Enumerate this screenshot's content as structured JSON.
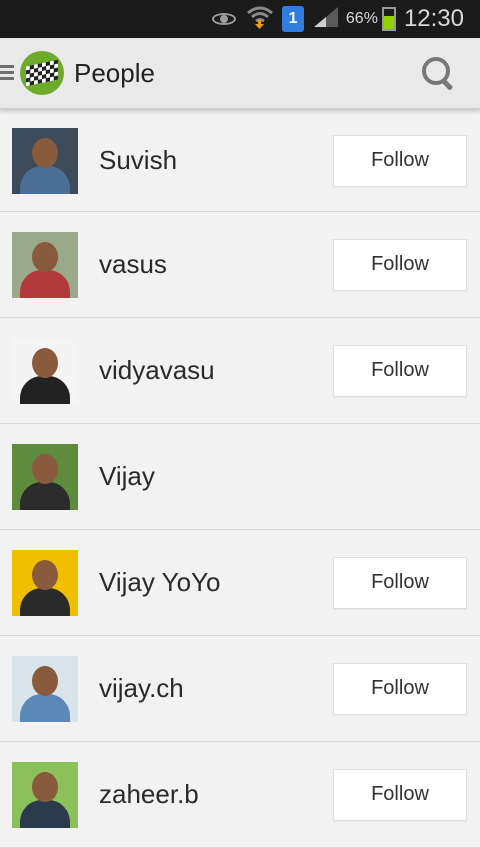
{
  "status_bar": {
    "notification_badge": "1",
    "battery_percent": "66%",
    "battery_level": 0.66,
    "time": "12:30",
    "icons": [
      "eye-icon",
      "wifi-download-icon",
      "notification-1-icon",
      "signal-icon",
      "battery-icon"
    ]
  },
  "action_bar": {
    "title": "People",
    "icons": [
      "menu-icon",
      "app-logo-icon",
      "search-icon"
    ]
  },
  "people": [
    {
      "name": "Suvish",
      "follow_label": "Follow",
      "has_follow": true,
      "avatar_colors": {
        "bg": "#3c4a59",
        "shirt": "#4a6e95"
      }
    },
    {
      "name": "vasus",
      "follow_label": "Follow",
      "has_follow": true,
      "avatar_colors": {
        "bg": "#9aa98a",
        "shirt": "#b23a3a"
      }
    },
    {
      "name": "vidyavasu",
      "follow_label": "Follow",
      "has_follow": true,
      "avatar_colors": {
        "bg": "#f4f4f4",
        "shirt": "#222222"
      }
    },
    {
      "name": "Vijay",
      "follow_label": "",
      "has_follow": false,
      "avatar_colors": {
        "bg": "#5f8b3e",
        "shirt": "#2b2b2b"
      }
    },
    {
      "name": "Vijay YoYo",
      "follow_label": "Follow",
      "has_follow": true,
      "avatar_colors": {
        "bg": "#f0c000",
        "shirt": "#2a2a2a"
      }
    },
    {
      "name": "vijay.ch",
      "follow_label": "Follow",
      "has_follow": true,
      "avatar_colors": {
        "bg": "#d9e3ea",
        "shirt": "#5c88b8"
      }
    },
    {
      "name": "zaheer.b",
      "follow_label": "Follow",
      "has_follow": true,
      "avatar_colors": {
        "bg": "#8cc05a",
        "shirt": "#2b3b4b"
      }
    }
  ]
}
